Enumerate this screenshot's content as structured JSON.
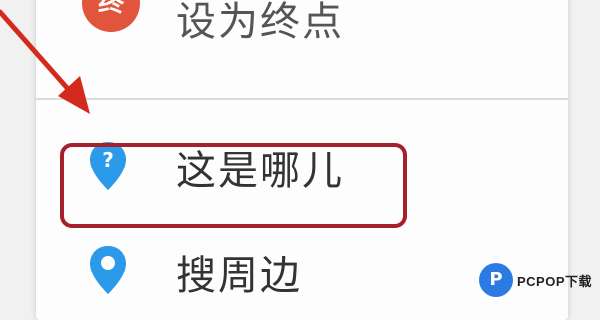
{
  "menu": {
    "items": [
      {
        "label": "设为终点",
        "icon": "end-point-icon",
        "icon_glyph": "终"
      },
      {
        "label": "这是哪儿",
        "icon": "location-question-pin-icon"
      },
      {
        "label": "搜周边",
        "icon": "location-pin-icon"
      }
    ],
    "highlight_color": "#a4202b",
    "pin_color": "#2b9ae8"
  },
  "annotation": {
    "arrow_color": "#d42a1e"
  },
  "watermark": {
    "logo_glyph": "P",
    "text": "PCPOP下载"
  }
}
